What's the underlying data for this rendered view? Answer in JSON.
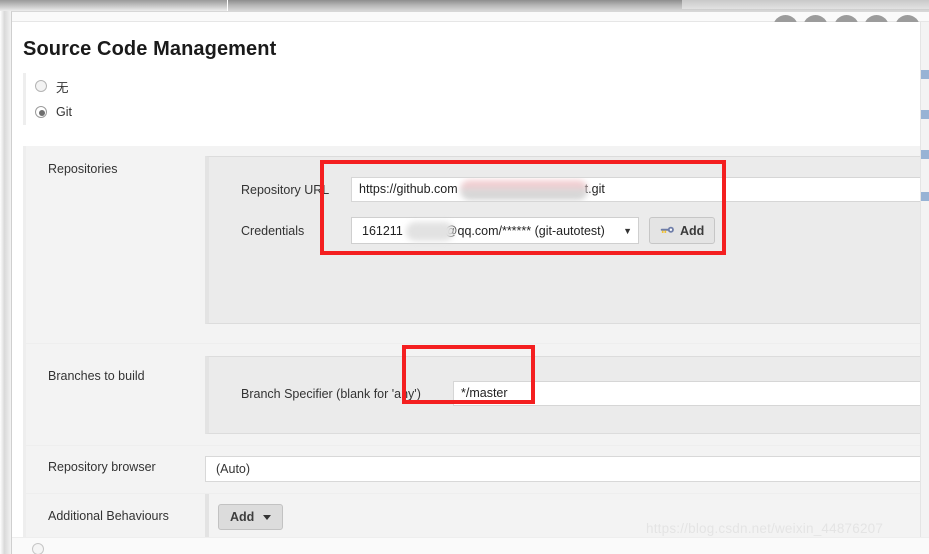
{
  "window": {
    "controls": [
      {
        "name": "skin-icon",
        "title": "Skin"
      },
      {
        "name": "pin-icon",
        "title": "Pin"
      },
      {
        "name": "minimize-icon",
        "title": "Minimize"
      },
      {
        "name": "maximize-icon",
        "title": "Maximize"
      },
      {
        "name": "close-icon",
        "title": "Close"
      }
    ]
  },
  "page": {
    "title": "Source Code Management"
  },
  "scm_options": [
    {
      "label": "无",
      "checked": false
    },
    {
      "label": "Git",
      "checked": true
    }
  ],
  "sections": {
    "repositories": {
      "label": "Repositories",
      "repository_url": {
        "label": "Repository URL",
        "value_prefix": "https://github.com",
        "value_suffix": "t.git"
      },
      "credentials": {
        "label": "Credentials",
        "value_prefix": "161211",
        "value_suffix": "@qq.com/****** (git-autotest)",
        "caret": "▼",
        "add_button": "Add"
      }
    },
    "branches": {
      "label": "Branches to build",
      "branch_specifier": {
        "label": "Branch Specifier (blank for 'any')",
        "value": "*/master"
      }
    },
    "repository_browser": {
      "label": "Repository browser",
      "value": "(Auto)"
    },
    "additional_behaviours": {
      "label": "Additional Behaviours",
      "add_button": "Add"
    }
  },
  "watermark": "https://blog.csdn.net/weixin_44876207",
  "colors": {
    "annotation": "#f41f20",
    "panel_bg": "#ebebeb",
    "row_bg": "#f3f3f3"
  }
}
